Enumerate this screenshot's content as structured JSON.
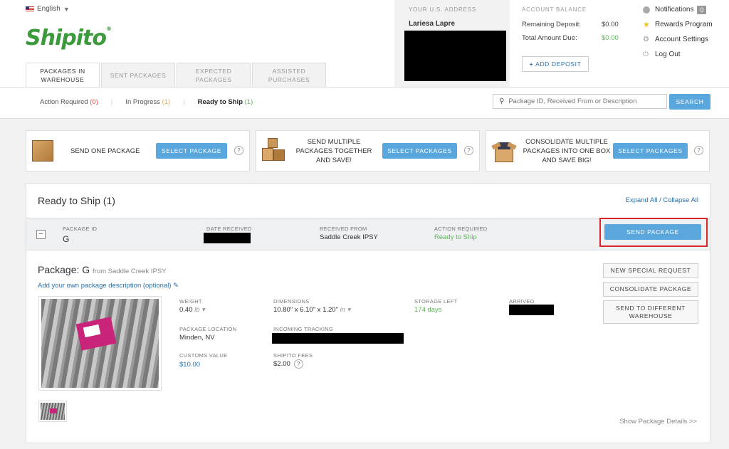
{
  "header": {
    "language": "English",
    "logo": "Shipito",
    "us_address": {
      "label": "YOUR U.S. ADDRESS",
      "name": "Lariesa Lapre"
    },
    "account_balance": {
      "label": "ACCOUNT BALANCE",
      "remaining_label": "Remaining Deposit:",
      "remaining_value": "$0.00",
      "due_label": "Total Amount Due:",
      "due_value": "$0.00",
      "add_deposit": "ADD DEPOSIT"
    },
    "user_menu": {
      "notifications": "Notifications",
      "notifications_count": "0",
      "rewards": "Rewards Program",
      "settings": "Account Settings",
      "logout": "Log Out"
    },
    "tabs": [
      {
        "label": "PACKAGES IN WAREHOUSE"
      },
      {
        "label": "SENT PACKAGES"
      },
      {
        "label": "EXPECTED PACKAGES"
      },
      {
        "label": "ASSISTED PURCHASES"
      }
    ]
  },
  "filters": {
    "action_required": "Action Required",
    "action_required_count": "(0)",
    "in_progress": "In Progress",
    "in_progress_count": "(1)",
    "ready_to_ship": "Ready to Ship",
    "ready_to_ship_count": "(1)"
  },
  "search": {
    "placeholder": "Package ID, Received From or Description",
    "button": "SEARCH"
  },
  "options": [
    {
      "text": "SEND ONE PACKAGE",
      "button": "SELECT PACKAGE",
      "help": "?"
    },
    {
      "text": "SEND MULTIPLE PACKAGES TOGETHER AND SAVE!",
      "button": "SELECT PACKAGES",
      "help": "?"
    },
    {
      "text": "CONSOLIDATE MULTIPLE PACKAGES INTO ONE BOX AND SAVE BIG!",
      "button": "SELECT PACKAGES",
      "help": "?"
    }
  ],
  "panel": {
    "title": "Ready to Ship (1)",
    "expand_all": "Expand All / Collapse All",
    "row": {
      "toggle": "−",
      "package_id_label": "PACKAGE ID",
      "package_id": "G",
      "date_label": "DATE RECEIVED",
      "received_from_label": "RECEIVED FROM",
      "received_from": "Saddle Creek IPSY",
      "action_label": "ACTION REQUIRED",
      "action": "Ready to Ship",
      "send_button": "SEND PACKAGE"
    },
    "detail": {
      "title_prefix": "Package:",
      "package_id": "G",
      "from": "from Saddle Creek IPSY",
      "add_description": "Add your own package description (optional)",
      "weight_label": "WEIGHT",
      "weight": "0.40",
      "weight_unit": "lb",
      "dimensions_label": "DIMENSIONS",
      "dimensions": "10.80\" x 6.10\" x 1.20\"",
      "dimensions_unit": "in",
      "storage_label": "STORAGE LEFT",
      "storage": "174 days",
      "arrived_label": "ARRIVED",
      "location_label": "PACKAGE LOCATION",
      "location": "Minden, NV",
      "tracking_label": "INCOMING TRACKING",
      "customs_label": "CUSTOMS VALUE",
      "customs": "$10.00",
      "fees_label": "SHIPITO FEES",
      "fees": "$2.00",
      "fees_help": "?",
      "new_request": "NEW SPECIAL REQUEST",
      "consolidate": "CONSOLIDATE PACKAGE",
      "send_different": "SEND TO DIFFERENT WAREHOUSE",
      "show_details": "Show Package Details >>"
    }
  },
  "colors": {
    "blue": "#5aa7dd",
    "green": "#5cb85c",
    "orange": "#f0ad4e",
    "red": "#e74c3c",
    "logo_green": "#3b9b3b",
    "highlight": "#d9262b"
  }
}
